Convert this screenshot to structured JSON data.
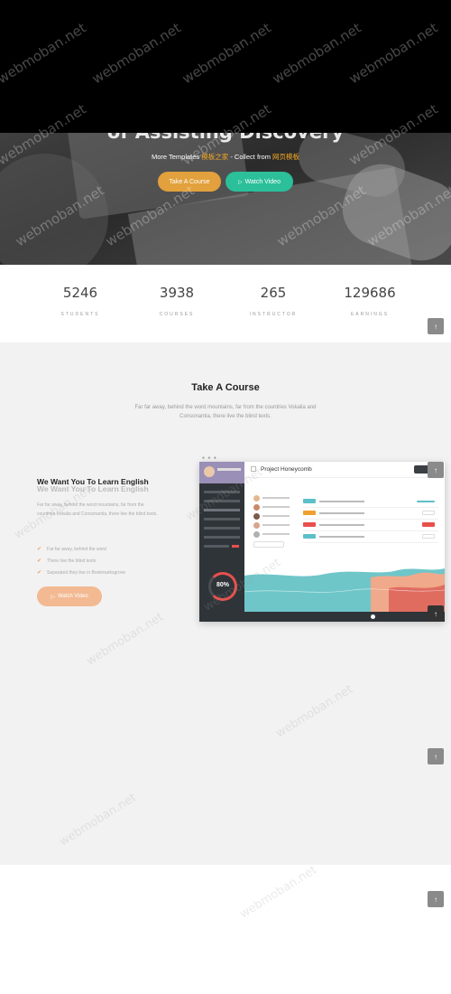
{
  "hero": {
    "title": "of Assisting Discovery",
    "sub_prefix": "More Templates ",
    "sub_hl1": "模板之家",
    "sub_mid": " - Collect from ",
    "sub_hl2": "网页模板",
    "btn_course": "Take A Course",
    "btn_video": "Watch Video"
  },
  "stats": [
    {
      "value": "5246",
      "label": "STUDENTS"
    },
    {
      "value": "3938",
      "label": "COURSES"
    },
    {
      "value": "265",
      "label": "INSTRUCTOR"
    },
    {
      "value": "129686",
      "label": "EARNINGS"
    }
  ],
  "course": {
    "title": "Take A Course",
    "desc": "Far far away, behind the word mountains, far from the countries Vokalia and Consonantia, there live the blind texts.",
    "learn_title": "We Want You To Learn English",
    "learn_desc": "Far far away, behind the word mountains, far from the countries Vokalia and Consonantia, there live the blind texts.",
    "list": [
      "Far far away, behind the word",
      "There live the blind texts",
      "Separated they live in Bookmarksgrove"
    ],
    "btn_watch": "Watch Video"
  },
  "dashboard": {
    "title": "Project Honeycomb",
    "gauge": "80%"
  },
  "watermark": "webmoban.net",
  "colors": {
    "accent_orange": "#e2a13c",
    "accent_green": "#2bbf9a",
    "watch_btn": "#f3b992"
  }
}
